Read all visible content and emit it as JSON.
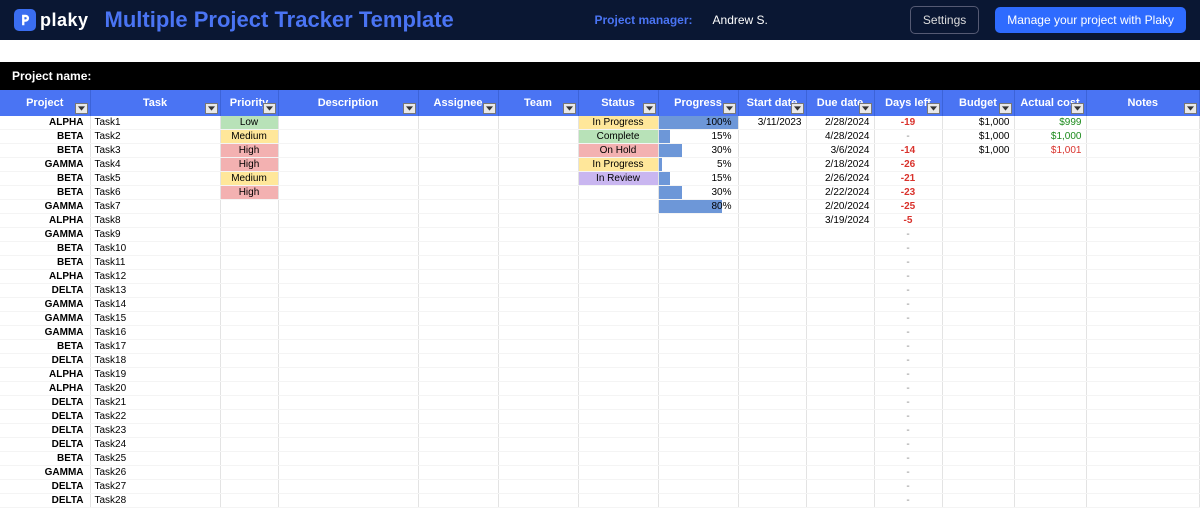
{
  "header": {
    "brand": "plaky",
    "title": "Multiple Project Tracker Template",
    "pm_label": "Project manager:",
    "pm_name": "Andrew S.",
    "settings_btn": "Settings",
    "cta_btn": "Manage your project with Plaky"
  },
  "subbar": {
    "label": "Project name:"
  },
  "columns": [
    {
      "key": "project",
      "label": "Project"
    },
    {
      "key": "task",
      "label": "Task"
    },
    {
      "key": "priority",
      "label": "Priority"
    },
    {
      "key": "desc",
      "label": "Description"
    },
    {
      "key": "assignee",
      "label": "Assignee"
    },
    {
      "key": "team",
      "label": "Team"
    },
    {
      "key": "status",
      "label": "Status"
    },
    {
      "key": "progress",
      "label": "Progress"
    },
    {
      "key": "sdate",
      "label": "Start date"
    },
    {
      "key": "ddate",
      "label": "Due date"
    },
    {
      "key": "days",
      "label": "Days left"
    },
    {
      "key": "budget",
      "label": "Budget"
    },
    {
      "key": "actual",
      "label": "Actual cost"
    },
    {
      "key": "notes",
      "label": "Notes"
    }
  ],
  "priority_colors": {
    "Low": "pri-low",
    "Medium": "pri-medium",
    "High": "pri-high",
    "Complete": "pri-complete"
  },
  "status_colors": {
    "In Progress": "st-inprogress",
    "Complete": "st-complete",
    "On Hold": "st-onhold",
    "In Review": "st-inreview"
  },
  "rows": [
    {
      "project": "ALPHA",
      "task": "Task1",
      "priority": "Low",
      "status": "In Progress",
      "progress": 100,
      "sdate": "3/11/2023",
      "ddate": "2/28/2024",
      "days": "-19",
      "days_neg": true,
      "budget": "$1,000",
      "actual": "$999",
      "actual_cls": "cost-green"
    },
    {
      "project": "BETA",
      "task": "Task2",
      "priority": "Medium",
      "status": "Complete",
      "progress": 15,
      "ddate": "4/28/2024",
      "days": "-",
      "budget": "$1,000",
      "actual": "$1,000",
      "actual_cls": "cost-green"
    },
    {
      "project": "BETA",
      "task": "Task3",
      "priority": "High",
      "status": "On Hold",
      "progress": 30,
      "ddate": "3/6/2024",
      "days": "-14",
      "days_neg": true,
      "budget": "$1,000",
      "actual": "$1,001",
      "actual_cls": "cost-red"
    },
    {
      "project": "GAMMA",
      "task": "Task4",
      "priority": "High",
      "status": "In Progress",
      "progress": 5,
      "ddate": "2/18/2024",
      "days": "-26",
      "days_neg": true
    },
    {
      "project": "BETA",
      "task": "Task5",
      "priority": "Medium",
      "status": "In Review",
      "progress": 15,
      "ddate": "2/26/2024",
      "days": "-21",
      "days_neg": true
    },
    {
      "project": "BETA",
      "task": "Task6",
      "priority": "High",
      "progress": 30,
      "ddate": "2/22/2024",
      "days": "-23",
      "days_neg": true
    },
    {
      "project": "GAMMA",
      "task": "Task7",
      "progress": 80,
      "ddate": "2/20/2024",
      "days": "-25",
      "days_neg": true
    },
    {
      "project": "ALPHA",
      "task": "Task8",
      "ddate": "3/19/2024",
      "days": "-5",
      "days_neg": true
    },
    {
      "project": "GAMMA",
      "task": "Task9",
      "days": "-"
    },
    {
      "project": "BETA",
      "task": "Task10",
      "days": "-"
    },
    {
      "project": "BETA",
      "task": "Task11",
      "days": "-"
    },
    {
      "project": "ALPHA",
      "task": "Task12",
      "days": "-"
    },
    {
      "project": "DELTA",
      "task": "Task13",
      "days": "-"
    },
    {
      "project": "GAMMA",
      "task": "Task14",
      "days": "-"
    },
    {
      "project": "GAMMA",
      "task": "Task15",
      "days": "-"
    },
    {
      "project": "GAMMA",
      "task": "Task16",
      "days": "-"
    },
    {
      "project": "BETA",
      "task": "Task17",
      "days": "-"
    },
    {
      "project": "DELTA",
      "task": "Task18",
      "days": "-"
    },
    {
      "project": "ALPHA",
      "task": "Task19",
      "days": "-"
    },
    {
      "project": "ALPHA",
      "task": "Task20",
      "days": "-"
    },
    {
      "project": "DELTA",
      "task": "Task21",
      "days": "-"
    },
    {
      "project": "DELTA",
      "task": "Task22",
      "days": "-"
    },
    {
      "project": "DELTA",
      "task": "Task23",
      "days": "-"
    },
    {
      "project": "DELTA",
      "task": "Task24",
      "days": "-"
    },
    {
      "project": "BETA",
      "task": "Task25",
      "days": "-"
    },
    {
      "project": "GAMMA",
      "task": "Task26",
      "days": "-"
    },
    {
      "project": "DELTA",
      "task": "Task27",
      "days": "-"
    },
    {
      "project": "DELTA",
      "task": "Task28",
      "days": "-"
    }
  ]
}
